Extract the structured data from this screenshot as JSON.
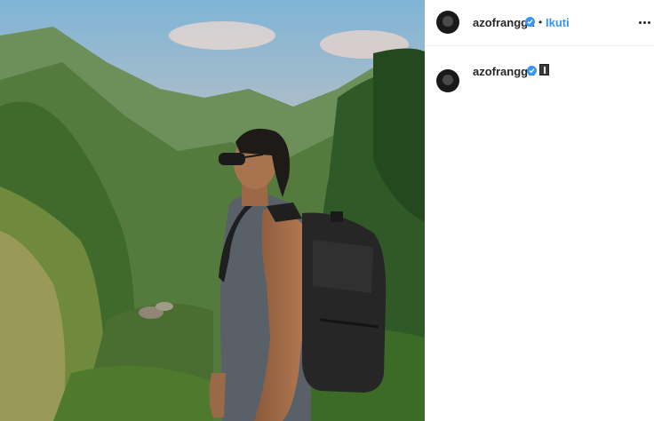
{
  "post": {
    "image_alt": "Man with sunglasses and black backpack standing in jungle valley"
  },
  "header": {
    "username": "azofrangga",
    "separator": "•",
    "follow_label": "Ikuti"
  },
  "caption": {
    "username": "azofrangga",
    "emoji": "mountain-icon"
  },
  "colors": {
    "accent": "#3897f0",
    "text": "#262626",
    "divider": "#efefef"
  }
}
